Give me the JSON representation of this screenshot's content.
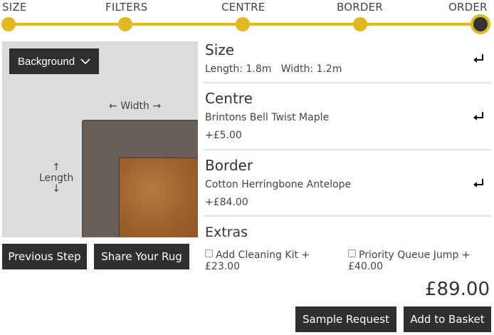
{
  "stepper": {
    "steps": [
      {
        "label": "SIZE"
      },
      {
        "label": "FILTERS"
      },
      {
        "label": "CENTRE"
      },
      {
        "label": "BORDER"
      },
      {
        "label": "ORDER",
        "active": true
      }
    ],
    "accent": "#e0b820",
    "active_color": "#333333"
  },
  "preview": {
    "background_button": "Background",
    "width_label": "Width",
    "length_label": "Length"
  },
  "actions": {
    "previous_step": "Previous Step",
    "share": "Share Your Rug",
    "sample_request": "Sample Request",
    "add_to_basket": "Add to Basket"
  },
  "summary": {
    "size": {
      "title": "Size",
      "length_label": "Length:",
      "length": "1.8m",
      "width_label": "Width:",
      "width": "1.2m"
    },
    "centre": {
      "title": "Centre",
      "name": "Brintons Bell Twist Maple",
      "price": "+£5.00"
    },
    "border": {
      "title": "Border",
      "name": "Cotton Herringbone Antelope",
      "price": "+£84.00"
    },
    "extras": {
      "title": "Extras",
      "options": [
        {
          "label": "Add Cleaning Kit +",
          "price": "£23.00",
          "checked": false
        },
        {
          "label": "Priority Queue Jump +",
          "price": "£40.00",
          "checked": false
        }
      ]
    },
    "total": "£89.00"
  }
}
